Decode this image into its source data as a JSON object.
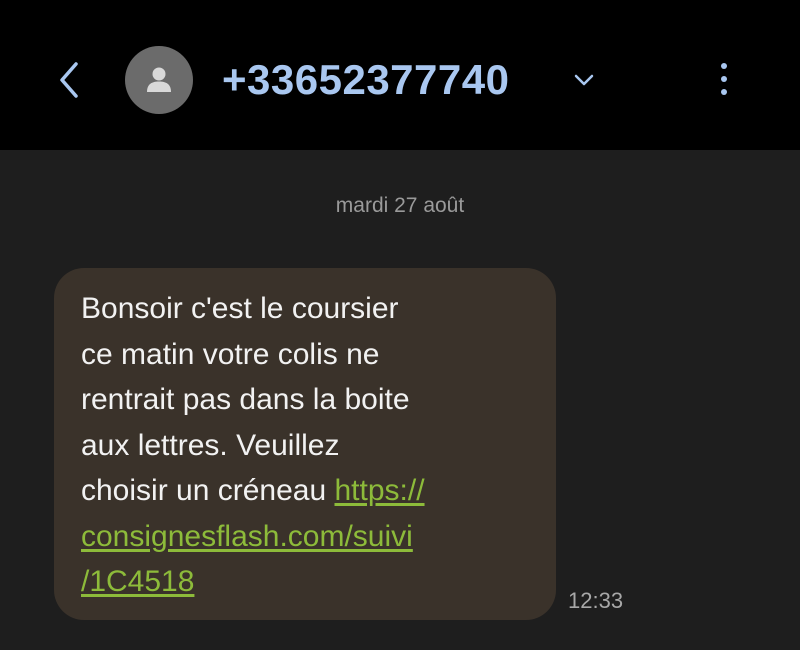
{
  "header": {
    "back_icon": "chevron-left-icon",
    "avatar_icon": "person-icon",
    "contact_number": "+33652377740",
    "expand_icon": "chevron-down-icon",
    "more_icon": "more-vertical-icon"
  },
  "conversation": {
    "date_divider": "mardi 27 août",
    "message": {
      "text_lines": [
        "Bonsoir c'est le coursier",
        "ce matin votre colis ne",
        "rentrait pas dans la boite",
        "aux lettres. Veuillez",
        "choisir un créneau "
      ],
      "link_lines": [
        "https://",
        "consignesflash.com/suivi",
        "/1C4518"
      ],
      "time": "12:33"
    }
  },
  "colors": {
    "header_bg": "#000000",
    "screen_bg": "#1e1e1e",
    "accent": "#a9c7f0",
    "bubble_bg": "#3a322a",
    "link": "#8dbb3a",
    "muted_text": "#9a9a9a"
  }
}
